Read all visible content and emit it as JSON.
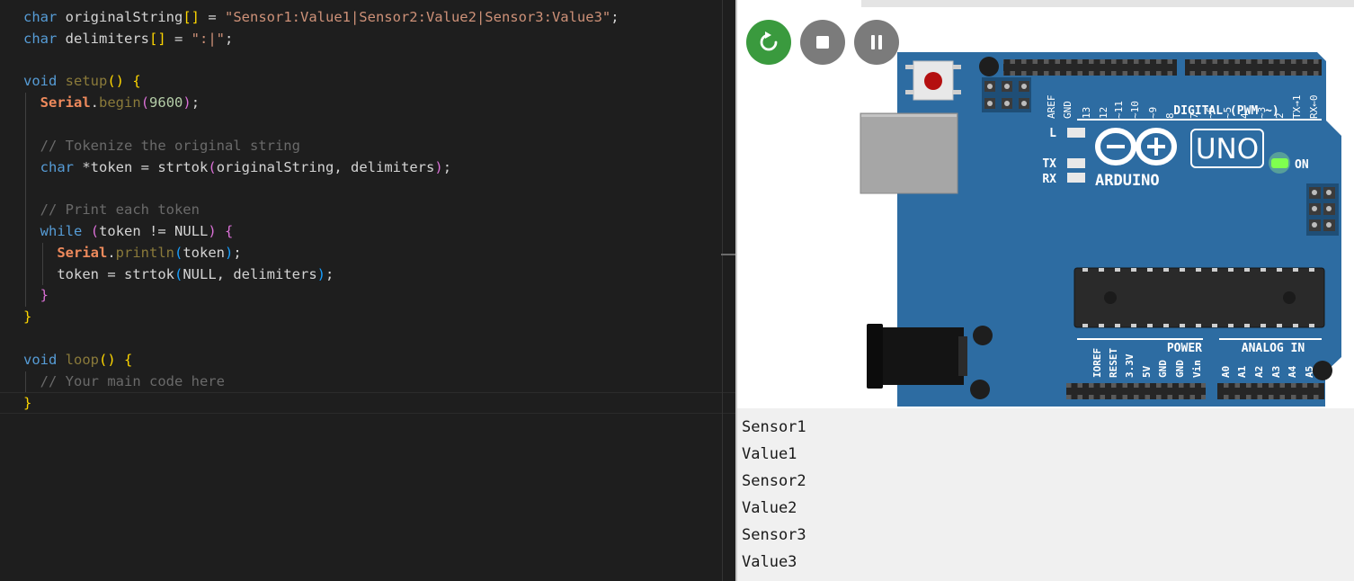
{
  "editor": {
    "code_lines": [
      "char originalString[] = \"Sensor1:Value1|Sensor2:Value2|Sensor3:Value3\";",
      "char delimiters[] = \":|\";",
      "",
      "void setup() {",
      "  Serial.begin(9600);",
      "",
      "  // Tokenize the original string",
      "  char *token = strtok(originalString, delimiters);",
      "",
      "  // Print each token",
      "  while (token != NULL) {",
      "    Serial.println(token);",
      "    token = strtok(NULL, delimiters);",
      "  }",
      "}",
      "",
      "void loop() {",
      "  // Your main code here",
      "}"
    ]
  },
  "toolbar": {
    "restart_icon": "restart-icon",
    "stop_icon": "stop-icon",
    "pause_icon": "pause-icon",
    "restart_color": "#3a9a3e",
    "button_color": "#7b7b7b"
  },
  "board": {
    "name": "UNO",
    "brand": "ARDUINO",
    "on_label": "ON",
    "led_l": "L",
    "led_tx": "TX",
    "led_rx": "RX",
    "digital_label": "DIGITAL (PWM ~)",
    "power_label": "POWER",
    "analog_label": "ANALOG IN",
    "digital_pins": [
      "AREF",
      "GND",
      "13",
      "12",
      "~11",
      "~10",
      "~9",
      "8",
      "7",
      "~6",
      "~5",
      "4",
      "~3",
      "2",
      "TX→1",
      "RX←0"
    ],
    "power_pins": [
      "IOREF",
      "RESET",
      "3.3V",
      "5V",
      "GND",
      "GND",
      "Vin"
    ],
    "analog_pins": [
      "A0",
      "A1",
      "A2",
      "A3",
      "A4",
      "A5"
    ],
    "board_color": "#2d6ca2",
    "led_on_color": "#7fff4f"
  },
  "serial_monitor": {
    "lines": [
      "Sensor1",
      "Value1",
      "Sensor2",
      "Value2",
      "Sensor3",
      "Value3"
    ]
  }
}
